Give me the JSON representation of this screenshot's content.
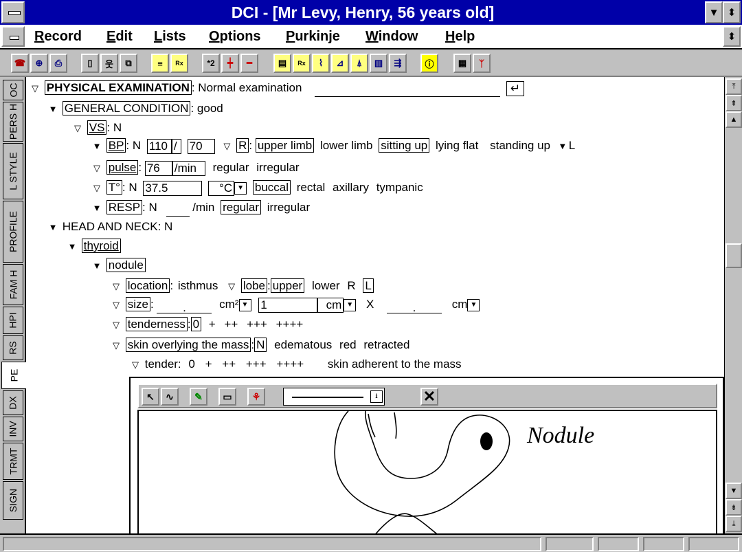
{
  "window": {
    "title": "DCI - [Mr Levy, Henry, 56 years old]"
  },
  "menu": [
    "Record",
    "Edit",
    "Lists",
    "Options",
    "Purkinje",
    "Window",
    "Help"
  ],
  "toolbar": {
    "buttons": [
      "phone-icon",
      "stethoscope-icon",
      "printer-icon",
      "new-document-icon",
      "patient-icon",
      "add-page-icon",
      "label-icon",
      "rx-label-icon",
      "multiply-2-icon",
      "plus-chart-icon",
      "minus-chart-icon",
      "notes-icon",
      "rx-icon",
      "graph-icon",
      "chart-icon",
      "lab-icon",
      "building-icon",
      "export-icon",
      "info-icon",
      "calendar-icon",
      "tree-icon"
    ],
    "x2_label": "*2",
    "rx_label": "Rx"
  },
  "side_tabs": [
    "OC",
    "PERS H",
    "L STYLE",
    "PROFILE",
    "FAM H",
    "HPI",
    "RS",
    "PE",
    "DX",
    "INV",
    "TRMT",
    "SIGN"
  ],
  "side_tab_active": "PE",
  "exam": {
    "pe_label": "PHYSICAL EXAMINATION",
    "pe_value": ": Normal examination",
    "general_label": "GENERAL CONDITION",
    "general_value": ": good",
    "vs_label": "VS",
    "vs_value": ": N",
    "bp_label": "BP",
    "bp_n": ": N",
    "bp_sys": "110",
    "bp_sep": "/",
    "bp_dia": "70",
    "bp_r": "R",
    "bp_colon": ":",
    "upper_limb": "upper limb",
    "lower_limb": "lower limb",
    "sitting_up": "sitting up",
    "lying_flat": "lying flat",
    "standing_up": "standing up",
    "bp_l": "L",
    "pulse_label": "pulse",
    "pulse_colon": ":",
    "pulse_value": "76",
    "pulse_unit": "/min",
    "regular": "regular",
    "irregular": "irregular",
    "temp_label": "T°",
    "temp_n": ": N",
    "temp_value": "37.5",
    "temp_unit": "°C",
    "buccal": "buccal",
    "rectal": "rectal",
    "axillary": "axillary",
    "tympanic": "tympanic",
    "resp_label": "RESP",
    "resp_n": ": N",
    "resp_unit": "/min",
    "resp_regular": "regular",
    "resp_irregular": "irregular",
    "head_neck": "HEAD AND NECK",
    "head_neck_value": ": N",
    "thyroid": "thyroid",
    "nodule": "nodule",
    "location_label": "location",
    "location_colon": ":",
    "isthmus": "isthmus",
    "lobe_label": "lobe",
    "lobe_colon": ":",
    "upper": "upper",
    "lower": "lower",
    "loc_r": "R",
    "loc_l": "L",
    "size_label": "size",
    "size_colon": ":",
    "size_dot1": ".",
    "size_unit1": "cm²",
    "size_value": "1",
    "size_unit2": "cm",
    "size_x": "X",
    "size_dot2": ".",
    "size_unit3": "cm",
    "tenderness_label": "tenderness",
    "tenderness_colon": ":",
    "tenderness_value": "0",
    "tend_1": "+",
    "tend_2": "++",
    "tend_3": "+++",
    "tend_4": "++++",
    "skin_label": "skin overlying the mass",
    "skin_colon": ":",
    "skin_n": "N",
    "edematous": "edematous",
    "red": "red",
    "retracted": "retracted",
    "tender_label": "tender:",
    "tender_0": "0",
    "tender_1": "+",
    "tender_2": "++",
    "tender_3": "+++",
    "tender_4": "++++",
    "skin_adherent": "skin adherent to the mass"
  },
  "drawing": {
    "annotation": "Nodule",
    "tools": [
      "pointer-icon",
      "freehand-icon",
      "pen-icon",
      "rectangle-icon",
      "stamp-icon"
    ],
    "line_style": "solid"
  }
}
